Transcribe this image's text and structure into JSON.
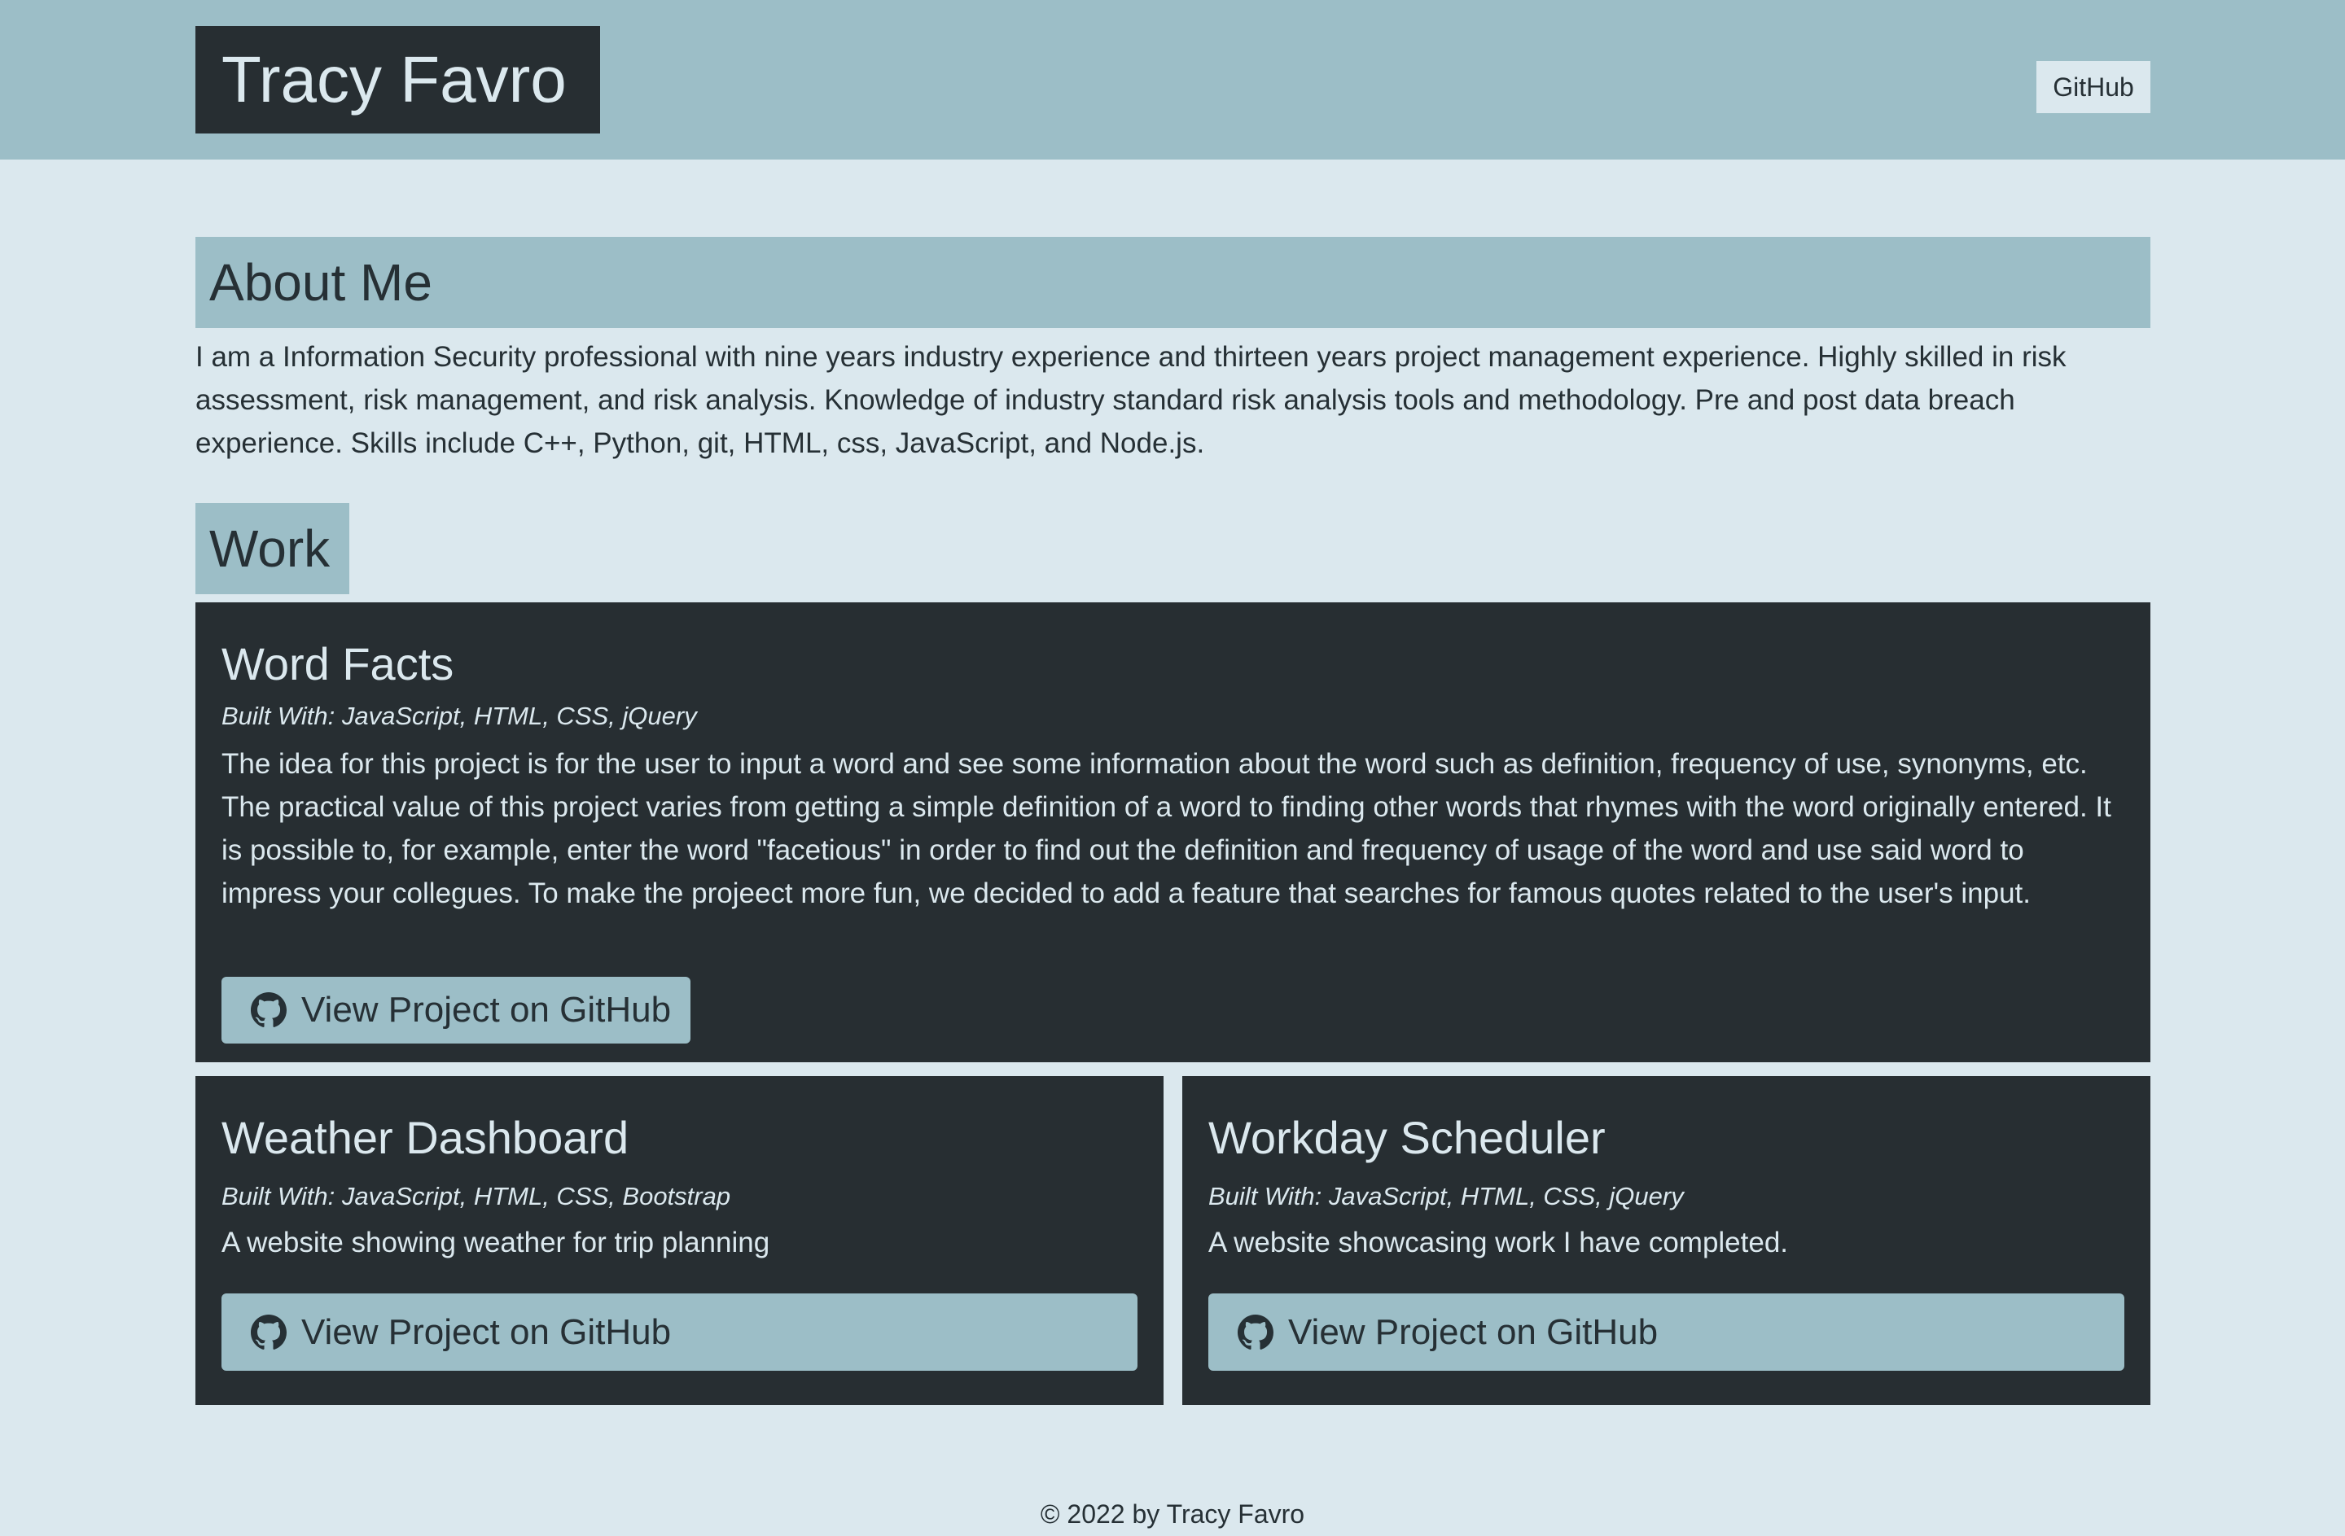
{
  "header": {
    "brand": "Tracy Favro",
    "nav_github": "GitHub"
  },
  "about": {
    "heading": "About Me",
    "text": "I am a Information Security professional with nine years industry experience and thirteen years project management experience. Highly skilled in risk assessment, risk management, and risk analysis. Knowledge of industry standard risk analysis tools and methodology. Pre and post data breach experience. Skills include C++, Python, git, HTML, css, JavaScript, and Node.js."
  },
  "work": {
    "heading": "Work",
    "projects": [
      {
        "title": "Word Facts",
        "built_with": "Built With: JavaScript, HTML, CSS, jQuery",
        "description": "The idea for this project is for the user to input a word and see some information about the word such as definition, frequency of use, synonyms, etc. The practical value of this project varies from getting a simple definition of a word to finding other words that rhymes with the word originally entered. It is possible to, for example, enter the word \"facetious\" in order to find out the definition and frequency of usage of the word and use said word to impress your collegues. To make the projeect more fun, we decided to add a feature that searches for famous quotes related to the user's input.",
        "button_label": "View Project on GitHub",
        "button_icon": "github-icon"
      },
      {
        "title": "Weather Dashboard",
        "built_with": "Built With: JavaScript, HTML, CSS, Bootstrap",
        "description": "A website showing weather for trip planning",
        "button_label": "View Project on GitHub",
        "button_icon": "github-icon"
      },
      {
        "title": "Workday Scheduler",
        "built_with": "Built With: JavaScript, HTML, CSS, jQuery",
        "description": "A website showcasing work I have completed.",
        "button_label": "View Project on GitHub",
        "button_icon": "github-icon"
      }
    ]
  },
  "footer": {
    "text": "© 2022 by Tracy Favro"
  },
  "colors": {
    "background": "#dbe8ee",
    "accent": "#9cbec7",
    "dark": "#272e32",
    "text": "#263035"
  }
}
